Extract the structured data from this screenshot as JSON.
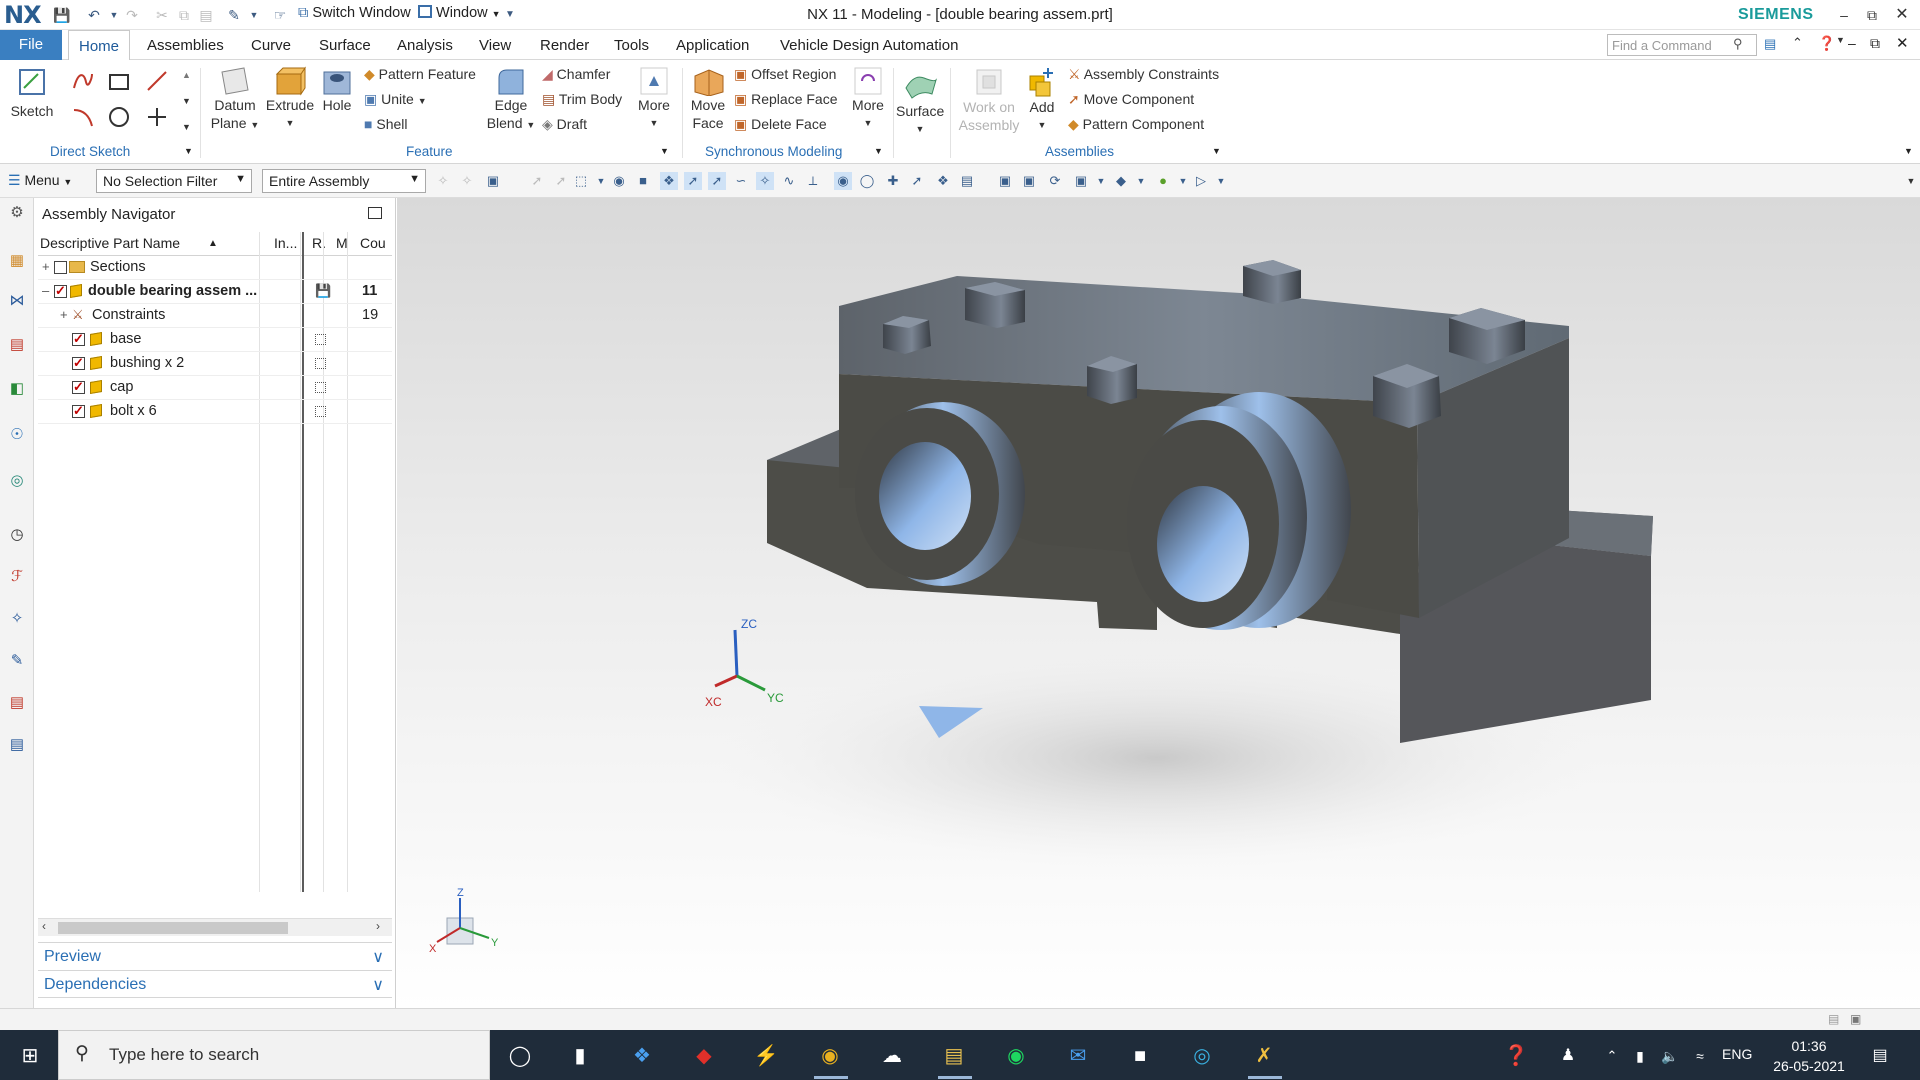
{
  "window": {
    "logo": "NX",
    "title": "NX 11 - Modeling - [double bearing assem.prt]",
    "brand": "SIEMENS",
    "switch_window": "Switch Window",
    "window_menu": "Window"
  },
  "menu_tabs": {
    "file": "File",
    "items": [
      "Home",
      "Assemblies",
      "Curve",
      "Surface",
      "Analysis",
      "View",
      "Render",
      "Tools",
      "Application",
      "Vehicle Design Automation"
    ],
    "active": "Home",
    "find_placeholder": "Find a Command"
  },
  "ribbon": {
    "direct_sketch": {
      "sketch": "Sketch",
      "group": "Direct Sketch"
    },
    "feature": {
      "datum_plane_1": "Datum",
      "datum_plane_2": "Plane",
      "extrude": "Extrude",
      "hole": "Hole",
      "pattern_feature": "Pattern Feature",
      "unite": "Unite",
      "shell": "Shell",
      "edge_blend_1": "Edge",
      "edge_blend_2": "Blend",
      "chamfer": "Chamfer",
      "trim_body": "Trim Body",
      "draft": "Draft",
      "more": "More",
      "group": "Feature"
    },
    "sync": {
      "move_face_1": "Move",
      "move_face_2": "Face",
      "offset_region": "Offset Region",
      "replace_face": "Replace Face",
      "delete_face": "Delete Face",
      "more": "More",
      "group": "Synchronous Modeling"
    },
    "surface": {
      "label": "Surface"
    },
    "assemblies": {
      "work_on_1": "Work on",
      "work_on_2": "Assembly",
      "add": "Add",
      "assembly_constraints": "Assembly Constraints",
      "move_component": "Move Component",
      "pattern_component": "Pattern Component",
      "group": "Assemblies"
    }
  },
  "selection_bar": {
    "menu": "Menu",
    "filter": "No Selection Filter",
    "scope": "Entire Assembly"
  },
  "navigator": {
    "title": "Assembly Navigator",
    "columns": [
      "Descriptive Part Name",
      "In...",
      "R.",
      "M",
      "Cou"
    ],
    "rows": [
      {
        "name": "Sections",
        "count": ""
      },
      {
        "name": "double bearing assem ...",
        "count": "11"
      },
      {
        "name": "Constraints",
        "count": "19"
      },
      {
        "name": "base",
        "count": ""
      },
      {
        "name": "bushing x 2",
        "count": ""
      },
      {
        "name": "cap",
        "count": ""
      },
      {
        "name": "bolt x 6",
        "count": ""
      }
    ],
    "preview": "Preview",
    "dependencies": "Dependencies"
  },
  "viewport": {
    "wcs_labels": {
      "z": "ZC",
      "x": "XC",
      "y": "YC"
    },
    "triad_labels": {
      "z": "Z",
      "x": "X",
      "y": "Y"
    }
  },
  "taskbar": {
    "search_placeholder": "Type here to search",
    "language": "ENG",
    "time": "01:36",
    "date": "26-05-2021"
  }
}
